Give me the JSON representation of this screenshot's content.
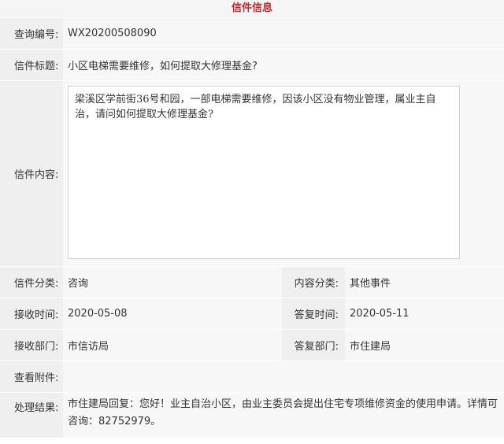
{
  "header": {
    "title": "信件信息"
  },
  "fields": {
    "query_no_label": "查询编号:",
    "query_no": "WX20200508090",
    "letter_title_label": "信件标题:",
    "letter_title": "小区电梯需要维修，如何提取大修理基金?",
    "content_label": "信件内容:",
    "content": "梁溪区学前街36号和园，一部电梯需要维修，因该小区没有物业管理，属业主自治，请问如何提取大修理基金?",
    "category_label": "信件分类:",
    "category": "咨询",
    "content_category_label": "内容分类:",
    "content_category": "其他事件",
    "received_time_label": "接收时间:",
    "received_time": "2020-05-08",
    "reply_time_label": "答复时间:",
    "reply_time": "2020-05-11",
    "received_dept_label": "接收部门:",
    "received_dept": "市信访局",
    "reply_dept_label": "答复部门:",
    "reply_dept": "市住建局",
    "attachments_label": "查看附件:",
    "attachments": "",
    "result_label": "处理结果:",
    "result": "市住建局回复：您好！业主自治小区，由业主委员会提出住宅专项维修资金的使用申请。详情可咨询：82752979。"
  }
}
